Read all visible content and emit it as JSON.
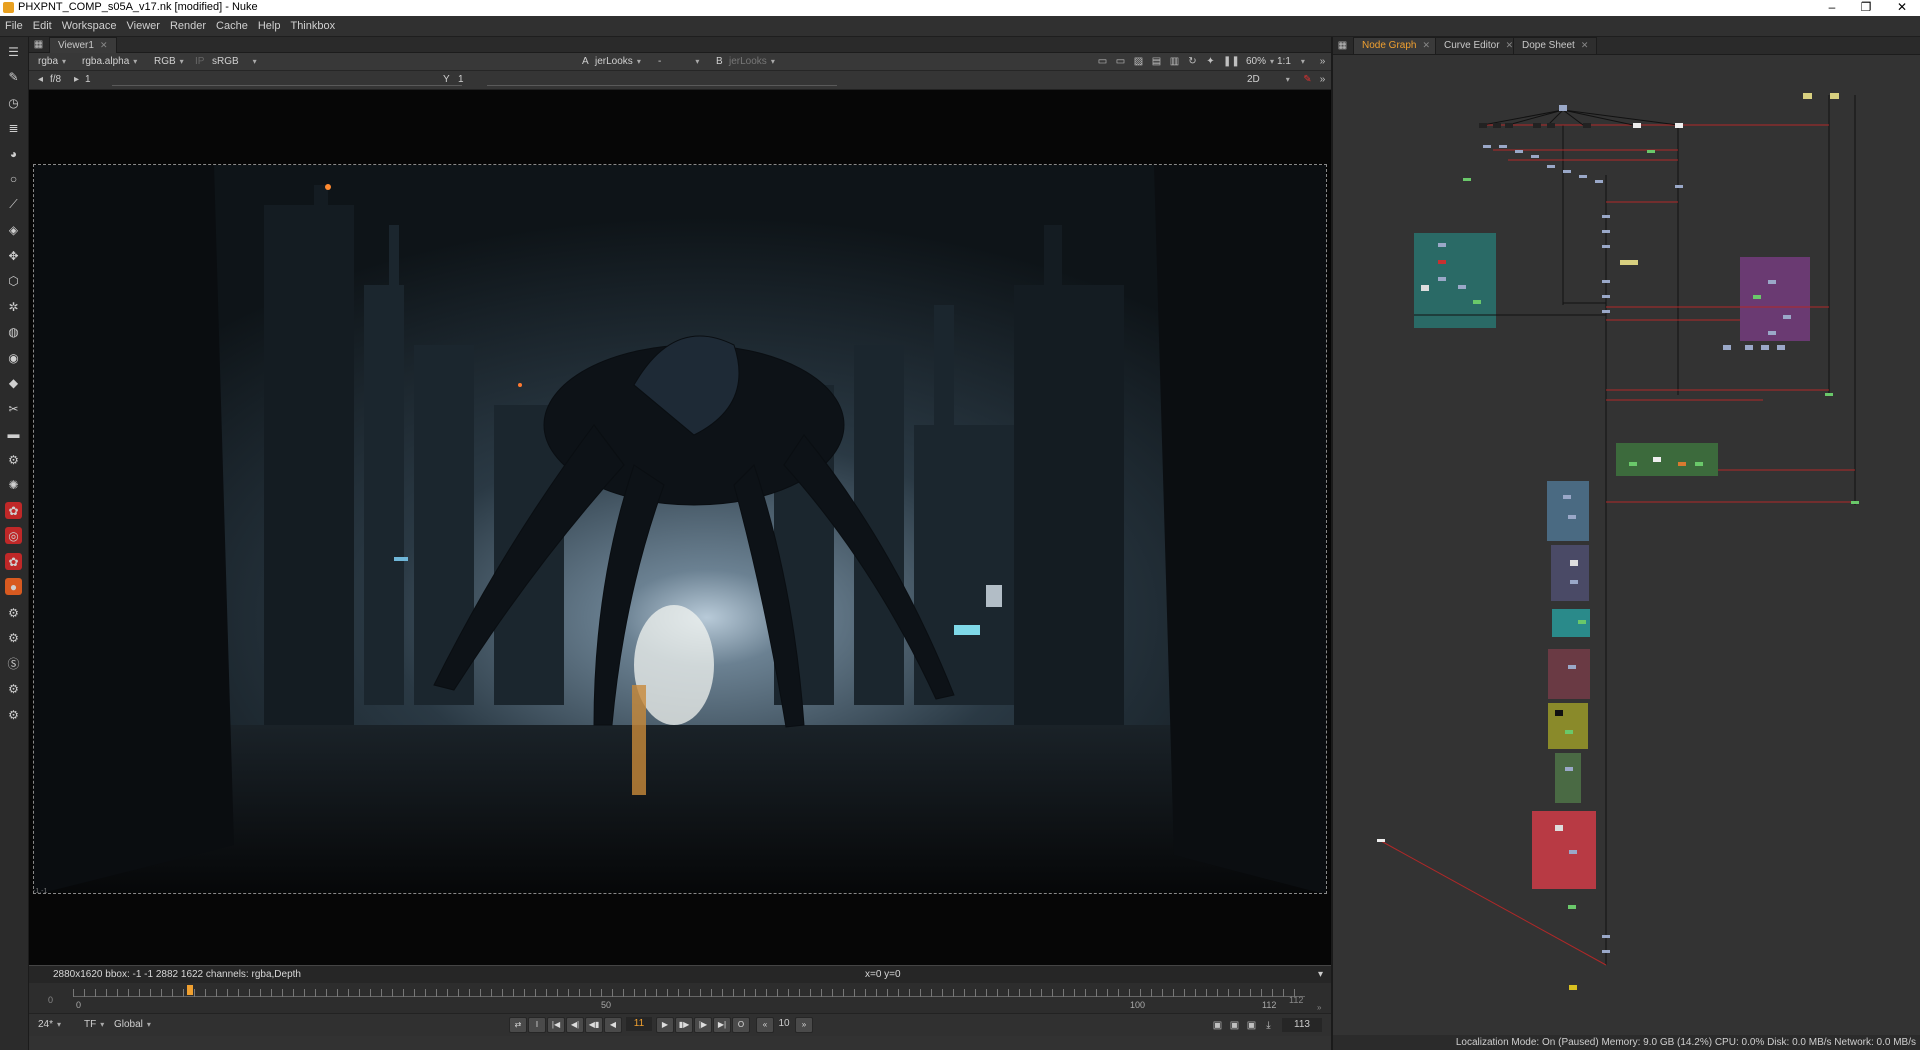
{
  "window": {
    "title": "PHXPNT_COMP_s05A_v17.nk [modified] - Nuke",
    "minimize": "–",
    "maximize": "❐",
    "close": "✕"
  },
  "menu": [
    "File",
    "Edit",
    "Workspace",
    "Viewer",
    "Render",
    "Cache",
    "Help",
    "Thinkbox"
  ],
  "viewer": {
    "tab": "Viewer1",
    "channels": "rgba",
    "alpha_channel": "rgba.alpha",
    "display_channels": "RGB",
    "ip_label": "IP",
    "lut": "sRGB",
    "input_a_label": "A",
    "input_a": "jerLooks",
    "input_a2": "-",
    "input_b_label": "B",
    "input_b": "jerLooks",
    "zoom": "60%",
    "ratio": "1:1",
    "fstop": "f/8",
    "gain": "1",
    "gamma_label": "Y",
    "gamma": "1",
    "view_mode": "2D",
    "info": "2880x1620  bbox: -1 -1 2882 1622 channels: rgba,Depth",
    "coords": "x=0 y=0",
    "corner_label": "-1,-1"
  },
  "timeline": {
    "start": "0",
    "end_label": "112",
    "tick_50": "50",
    "tick_100": "100",
    "tick_0": "0",
    "current_frame": "11",
    "fps": "24*",
    "tf": "TF",
    "range": "Global",
    "step": "10",
    "last_frame": "113"
  },
  "right_tabs": [
    "Node Graph",
    "Curve Editor",
    "Dope Sheet"
  ],
  "status": "Localization Mode: On (Paused) Memory: 9.0 GB (14.2%) CPU: 0.0% Disk: 0.0 MB/s Network: 0.0 MB/s",
  "toolbar_icons": [
    "toolbar-menu-icon",
    "paint-brush-icon",
    "time-icon",
    "channel-icon",
    "color-icon",
    "filter-icon",
    "keyer-icon",
    "merge-icon",
    "transform-icon",
    "3d-icon",
    "views-icon",
    "metadata-icon",
    "other-icon",
    "deep-icon",
    "particles-icon",
    "ofx-icon",
    "wrench-icon",
    "dial-icon",
    "atom-icon",
    "plugin-red-icon",
    "plugin-ring-icon",
    "plugin-red2-icon",
    "plugin-orange-icon",
    "gizmo-icon",
    "gizmo2-icon",
    "s-icon",
    "gizmo3-icon",
    "gizmo4-icon"
  ],
  "colors": {
    "accent": "#f0a030",
    "viewer_bg": "#060606",
    "graph_bg": "#333333"
  }
}
